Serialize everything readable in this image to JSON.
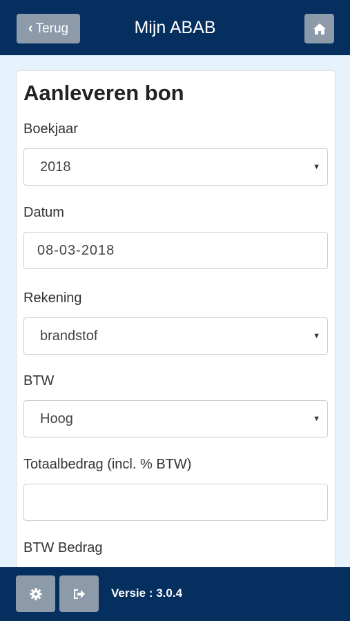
{
  "header": {
    "back_label": "Terug",
    "title": "Mijn ABAB",
    "back_icon": "chevron-left-icon",
    "home_icon": "home-icon"
  },
  "form": {
    "title": "Aanleveren bon",
    "fields": [
      {
        "label": "Boekjaar",
        "type": "select",
        "value": "2018"
      },
      {
        "label": "Datum",
        "type": "date",
        "value": "08-03-2018"
      },
      {
        "label": "Rekening",
        "type": "select",
        "value": "brandstof"
      },
      {
        "label": "BTW",
        "type": "select",
        "value": "Hoog"
      },
      {
        "label": "Totaalbedrag (incl. % BTW)",
        "type": "text",
        "value": ""
      },
      {
        "label": "BTW Bedrag",
        "type": "text",
        "value": ""
      }
    ]
  },
  "footer": {
    "settings_icon": "gear-icon",
    "logout_icon": "sign-out-icon",
    "version_text": "Versie : 3.0.4"
  },
  "colors": {
    "header_bg": "#052f5f",
    "button_bg": "#8c9aaa",
    "page_bg": "#e6f2fb"
  }
}
